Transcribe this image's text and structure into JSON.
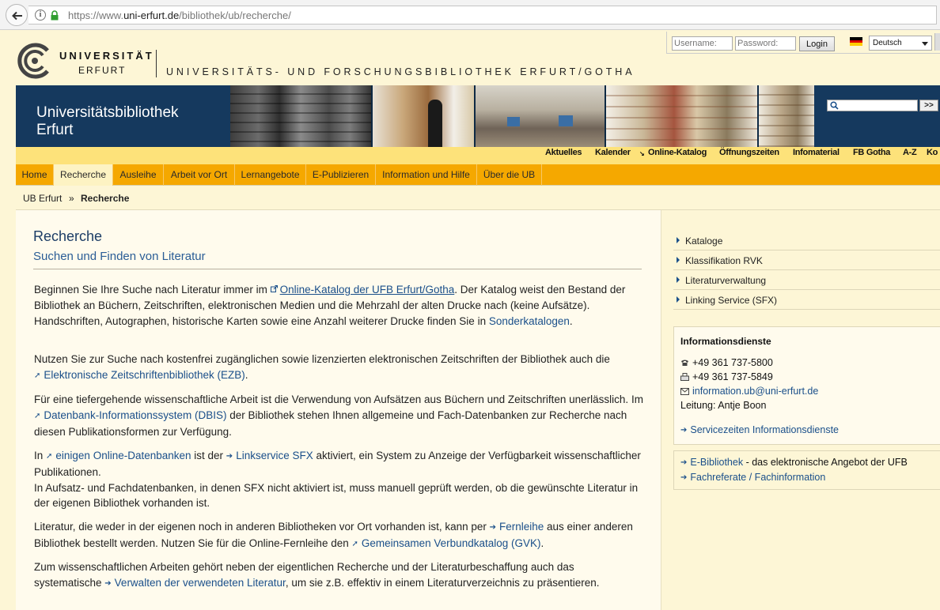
{
  "browser": {
    "url_prefix": "https://www.",
    "url_domain": "uni-erfurt.de",
    "url_path": "/bibliothek/ub/recherche/"
  },
  "header": {
    "logo_line1": "UNIVERSITÄT",
    "logo_line2": "ERFURT",
    "library_name": "UNIVERSITÄTS- UND FORSCHUNGSBIBLIOTHEK ERFURT/GOTHA",
    "username_placeholder": "Username:",
    "password_placeholder": "Password:",
    "login_label": "Login",
    "language": "Deutsch"
  },
  "banner": {
    "title_line1": "Universitätsbibliothek",
    "title_line2": "Erfurt",
    "search_button": ">>"
  },
  "util_nav": [
    "Aktuelles",
    "Kalender",
    "Online-Katalog",
    "Öffnungszeiten",
    "Infomaterial",
    "FB Gotha",
    "A-Z",
    "Ko"
  ],
  "main_nav": [
    "Home",
    "Recherche",
    "Ausleihe",
    "Arbeit vor Ort",
    "Lernangebote",
    "E-Publizieren",
    "Information und Hilfe",
    "Über die UB"
  ],
  "breadcrumb": {
    "home": "UB Erfurt",
    "sep": "»",
    "current": "Recherche"
  },
  "content": {
    "title": "Recherche",
    "subtitle": "Suchen und Finden von Literatur",
    "p1": {
      "a": "Beginnen Sie Ihre Suche nach Literatur immer im ",
      "link1": "Online-Katalog der UFB Erfurt/Gotha",
      "b": ". Der Katalog weist den Bestand der Bibliothek an Büchern, Zeitschriften, elektronischen Medien und die Mehrzahl der alten Drucke nach (keine Aufsätze).",
      "c": "Handschriften, Autographen, historische Karten sowie eine Anzahl weiterer Drucke finden Sie in ",
      "link2": "Sonderkatalogen",
      "d": "."
    },
    "p2": {
      "a": "Nutzen Sie zur Suche nach kostenfrei zugänglichen sowie lizenzierten elektronischen Zeitschriften der Bibliothek auch die ",
      "link1": "Elektronische Zeitschriftenbibliothek (EZB)",
      "b": "."
    },
    "p3": {
      "a": "Für eine tiefergehende wissenschaftliche Arbeit ist die Verwendung von Aufsätzen aus Büchern und Zeitschriften unerlässlich. Im ",
      "link1": "Datenbank-Informationssystem (DBIS)",
      "b": " der Bibliothek stehen Ihnen allgemeine und Fach-Datenbanken zur Recherche nach diesen Publikationsformen zur Verfügung."
    },
    "p4": {
      "a": "In ",
      "link1": "einigen Online-Datenbanken",
      "b": " ist der ",
      "link2": "Linkservice SFX",
      "c": " aktiviert, ein System zu Anzeige der Verfügbarkeit wissenschaftlicher Publikationen.",
      "d": "In Aufsatz- und Fachdatenbanken, in denen SFX nicht aktiviert ist, muss manuell geprüft werden, ob die gewünschte Literatur in der eigenen Bibliothek vorhanden ist."
    },
    "p5": {
      "a": "Literatur, die weder in der eigenen noch in anderen Bibliotheken vor Ort vorhanden ist, kann per ",
      "link1": "Fernleihe",
      "b": " aus einer anderen Bibliothek bestellt werden. Nutzen Sie für die Online-Fernleihe den ",
      "link2": "Gemeinsamen Verbundkatalog (GVK)",
      "c": "."
    },
    "p6": {
      "a": "Zum wissenschaftlichen Arbeiten gehört neben der eigentlichen Recherche und der Literaturbeschaffung auch das systematische ",
      "link1": "Verwalten der verwendeten Literatur",
      "b": ", um sie z.B. effektiv in einem Literaturverzeichnis zu präsentieren."
    }
  },
  "sidebar": {
    "links": [
      "Kataloge",
      "Klassifikation RVK",
      "Literaturverwaltung",
      "Linking Service (SFX)"
    ],
    "info": {
      "title": "Informationsdienste",
      "phone": "+49 361 737-5800",
      "fax": "+49 361 737-5849",
      "email": "information.ub@uni-erfurt.de",
      "leitung": "Leitung: Antje Boon",
      "service_link": "Servicezeiten Informationsdienste"
    },
    "extra": {
      "ebib_link": "E-Bibliothek",
      "ebib_text": " - das elektronische Angebot der UFB",
      "fach_link": "Fachreferate / Fachinformation"
    }
  }
}
